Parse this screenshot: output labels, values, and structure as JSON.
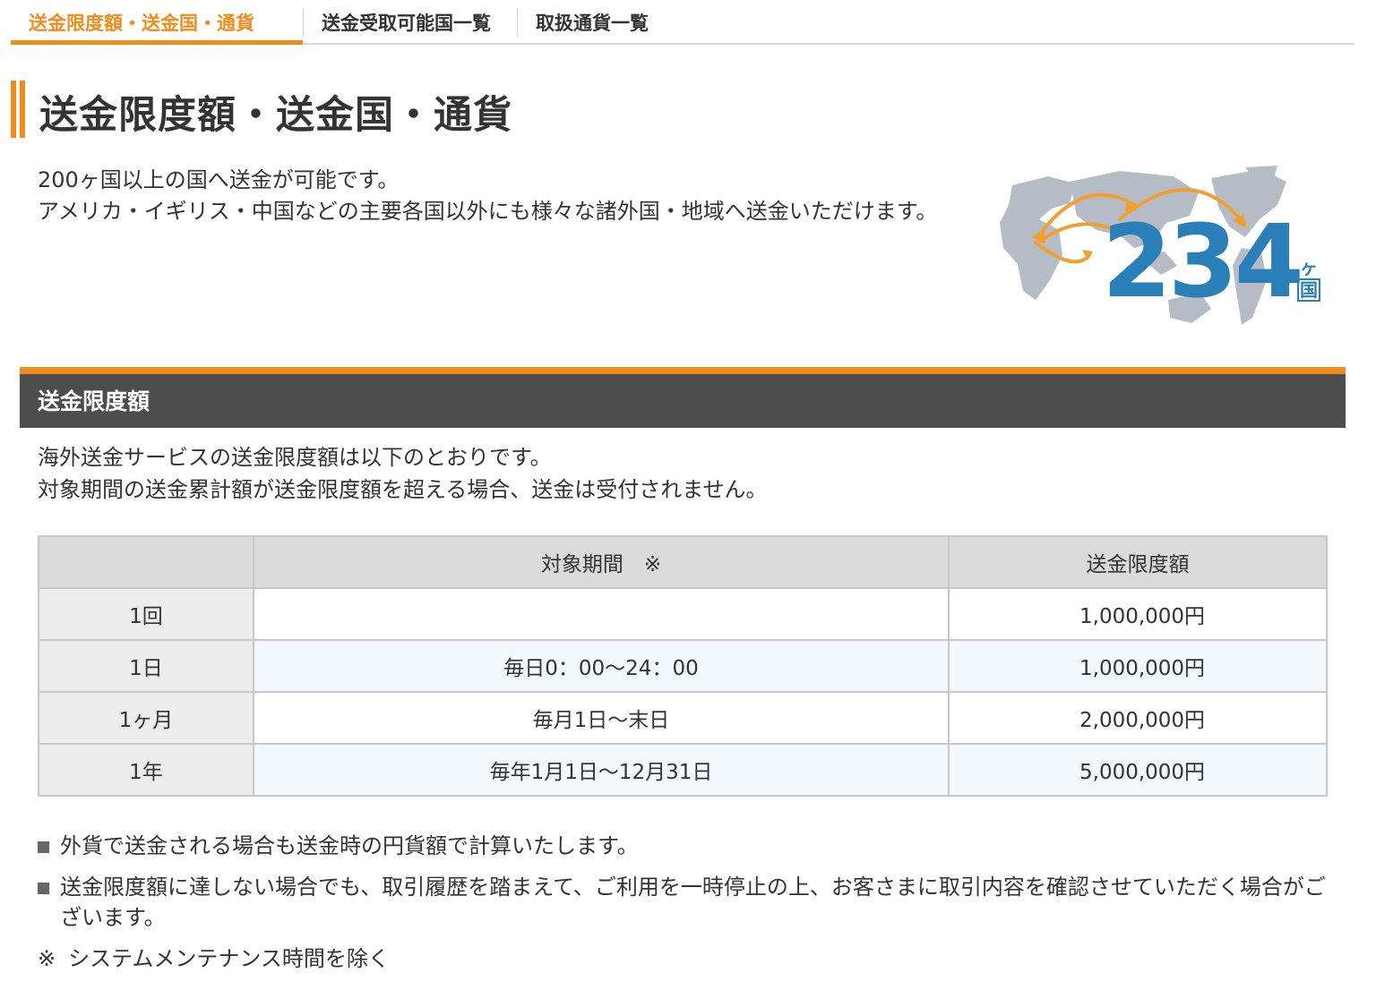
{
  "tabs": [
    {
      "label": "送金限度額・送金国・通貨",
      "active": true
    },
    {
      "label": "送金受取可能国一覧",
      "active": false
    },
    {
      "label": "取扱通貨一覧",
      "active": false
    }
  ],
  "page_title": "送金限度額・送金国・通貨",
  "intro": {
    "line1": "200ヶ国以上の国へ送金が可能です。",
    "line2": "アメリカ・イギリス・中国などの主要各国以外にも様々な諸外国・地域へ送金いただけます。"
  },
  "graphic": {
    "number": "234",
    "unit_top": "ヶ",
    "unit_bottom": "国",
    "number_color": "#2a7fb8",
    "arrow_color": "#f0a030",
    "map_color": "#b6bcc6"
  },
  "section": {
    "title": "送金限度額",
    "desc1": "海外送金サービスの送金限度額は以下のとおりです。",
    "desc2": "対象期間の送金累計額が送金限度額を超える場合、送金は受付されません。"
  },
  "table": {
    "headers": [
      "",
      "対象期間　※",
      "送金限度額"
    ],
    "rows": [
      {
        "unit": "1回",
        "period": "",
        "amount": "1,000,000円"
      },
      {
        "unit": "1日",
        "period": "毎日0：00〜24：00",
        "amount": "1,000,000円"
      },
      {
        "unit": "1ヶ月",
        "period": "毎月1日〜末日",
        "amount": "2,000,000円"
      },
      {
        "unit": "1年",
        "period": "毎年1月1日〜12月31日",
        "amount": "5,000,000円"
      }
    ]
  },
  "notes": [
    "外貨で送金される場合も送金時の円貨額で計算いたします。",
    "送金限度額に達しない場合でも、取引履歴を踏まえて、ご利用を一時停止の上、お客さまに取引内容を確認させていただく場合がございます。"
  ],
  "footnote": {
    "mark": "※",
    "text": "システムメンテナンス時間を除く"
  },
  "colors": {
    "accent": "#f08c1e",
    "section_bg": "#4d4d4d"
  }
}
